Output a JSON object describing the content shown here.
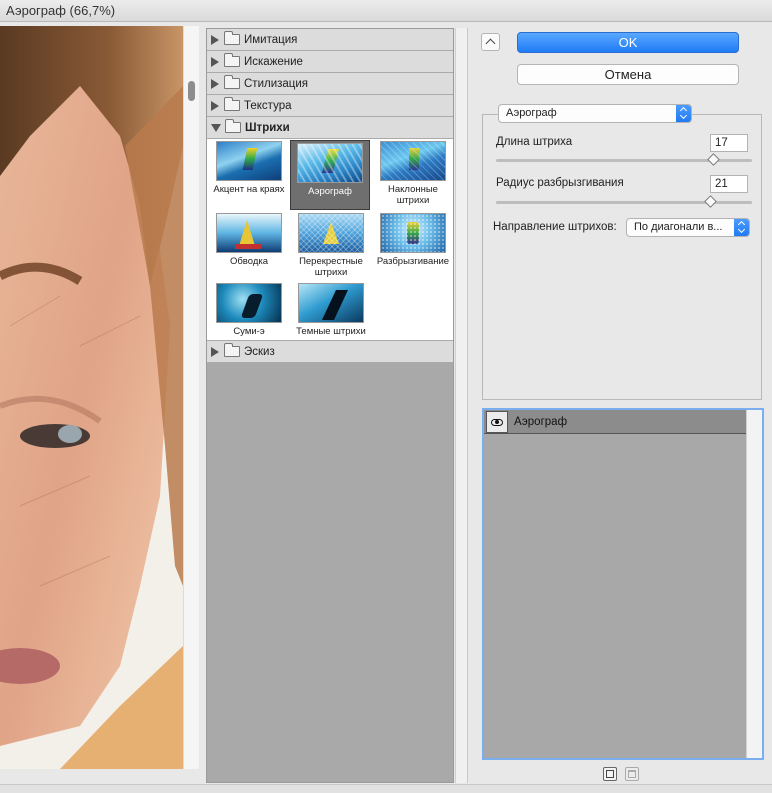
{
  "window": {
    "title": "Аэрограф (66,7%)"
  },
  "gallery": {
    "categories_top": [
      {
        "label": "Имитация"
      },
      {
        "label": "Искажение"
      },
      {
        "label": "Стилизация"
      },
      {
        "label": "Текстура"
      }
    ],
    "open_category": {
      "label": "Штрихи"
    },
    "filters": [
      {
        "label": "Акцент на краях"
      },
      {
        "label": "Аэрограф"
      },
      {
        "label": "Наклонные штрихи"
      },
      {
        "label": "Обводка"
      },
      {
        "label": "Перекрестные штрихи"
      },
      {
        "label": "Разбрызгивание"
      },
      {
        "label": "Суми-э"
      },
      {
        "label": "Темные штрихи"
      }
    ],
    "categories_bottom": [
      {
        "label": "Эскиз"
      }
    ],
    "selected_filter": "Аэрограф"
  },
  "actions": {
    "ok_label": "OK",
    "cancel_label": "Отмена"
  },
  "settings": {
    "filter_select": "Аэрограф",
    "stroke_length": {
      "label": "Длина штриха",
      "value": "17",
      "slider_fraction": 0.85
    },
    "spray_radius": {
      "label": "Радиус разбрызгивания",
      "value": "21",
      "slider_fraction": 0.84
    },
    "direction": {
      "label": "Направление штрихов:",
      "value": "По диагонали в..."
    }
  },
  "layers": {
    "items": [
      {
        "name": "Аэрограф",
        "visible": true
      }
    ]
  },
  "colors": {
    "accent": "#1f7cf5",
    "selection_border": "#79aef0",
    "panel_bg": "#e8e8e8",
    "gallery_bg": "#a9a9a9"
  }
}
